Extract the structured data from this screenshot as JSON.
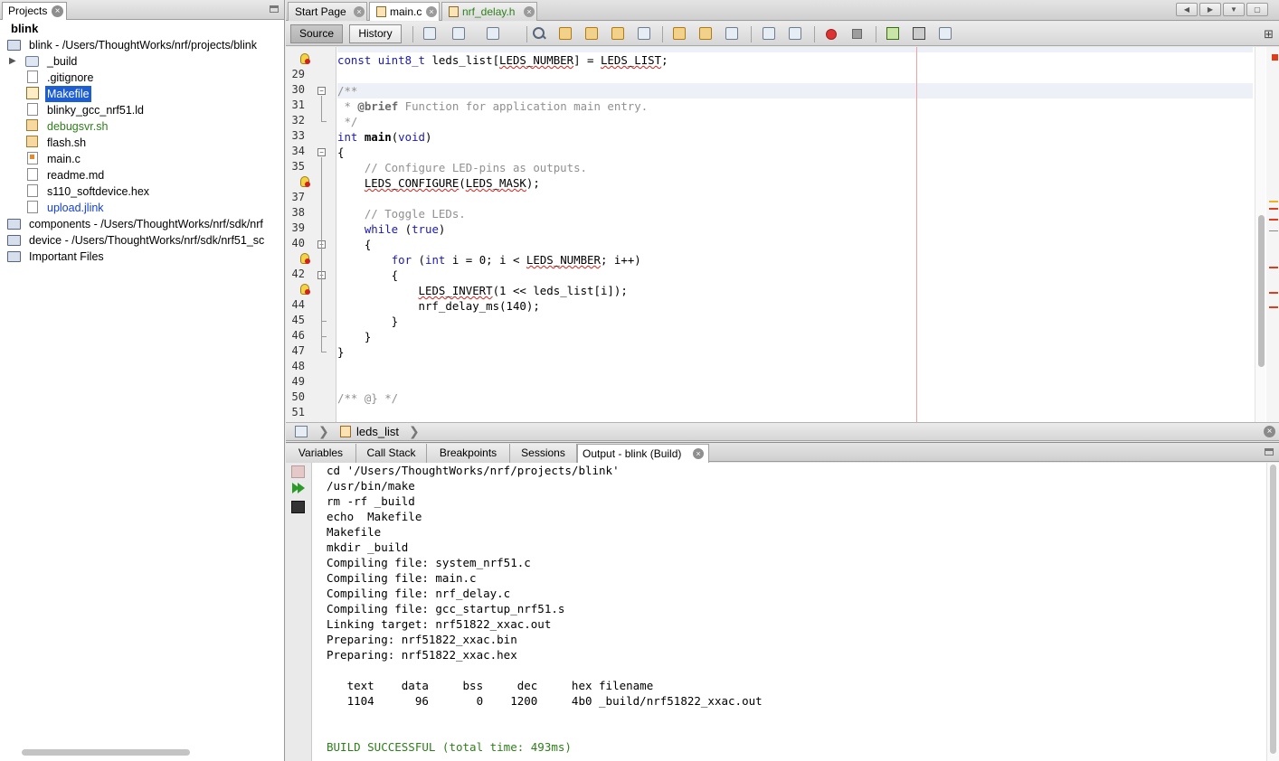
{
  "projects_panel": {
    "tab_label": "Projects",
    "tree": [
      {
        "label": "blink",
        "kind": "root"
      },
      {
        "label": "blink - /Users/ThoughtWorks/nrf/projects/blink",
        "kind": "project"
      },
      {
        "label": "_build",
        "kind": "folder"
      },
      {
        "label": ".gitignore",
        "kind": "file"
      },
      {
        "label": "Makefile",
        "kind": "makefile",
        "selected": true
      },
      {
        "label": "blinky_gcc_nrf51.ld",
        "kind": "file"
      },
      {
        "label": "debugsvr.sh",
        "kind": "shell",
        "color": "green"
      },
      {
        "label": "flash.sh",
        "kind": "shell"
      },
      {
        "label": "main.c",
        "kind": "c"
      },
      {
        "label": "readme.md",
        "kind": "file"
      },
      {
        "label": "s110_softdevice.hex",
        "kind": "file"
      },
      {
        "label": "upload.jlink",
        "kind": "file",
        "color": "blue"
      },
      {
        "label": "components - /Users/ThoughtWorks/nrf/sdk/nrf",
        "kind": "project"
      },
      {
        "label": "device - /Users/ThoughtWorks/nrf/sdk/nrf51_sc",
        "kind": "project"
      },
      {
        "label": "Important Files",
        "kind": "project"
      }
    ]
  },
  "editor_tabs": [
    {
      "label": "Start Page",
      "active": false
    },
    {
      "label": "main.c",
      "active": true
    },
    {
      "label": "nrf_delay.h",
      "active": false,
      "color": "green"
    }
  ],
  "editor_toolbar": {
    "source_label": "Source",
    "history_label": "History"
  },
  "code": {
    "line_numbers": [
      "",
      "29",
      "30",
      "31",
      "32",
      "33",
      "34",
      "35",
      "",
      "37",
      "38",
      "39",
      "40",
      "",
      "42",
      "",
      "44",
      "45",
      "46",
      "47",
      "48",
      "49",
      "50",
      "51"
    ],
    "lines": [
      [
        {
          "t": "const ",
          "c": "kw"
        },
        {
          "t": "uint8_t",
          "c": "ty"
        },
        {
          "t": " leds_list["
        },
        {
          "t": "LEDS_NUMBER",
          "c": "squig"
        },
        {
          "t": "] = "
        },
        {
          "t": "LEDS_LIST",
          "c": "squig"
        },
        {
          "t": ";"
        }
      ],
      [],
      [
        {
          "t": "/**",
          "c": "cm"
        }
      ],
      [
        {
          "t": " * ",
          "c": "cm"
        },
        {
          "t": "@brief",
          "c": "cmb"
        },
        {
          "t": " Function for application main entry.",
          "c": "cm"
        }
      ],
      [
        {
          "t": " */",
          "c": "cm"
        }
      ],
      [
        {
          "t": "int ",
          "c": "kw"
        },
        {
          "t": "main",
          "c": "fn"
        },
        {
          "t": "("
        },
        {
          "t": "void",
          "c": "kw"
        },
        {
          "t": ")"
        }
      ],
      [
        {
          "t": "{"
        }
      ],
      [
        {
          "t": "    // Configure LED-pins as outputs.",
          "c": "cm"
        }
      ],
      [
        {
          "t": "    "
        },
        {
          "t": "LEDS_CONFIGURE",
          "c": "squig"
        },
        {
          "t": "("
        },
        {
          "t": "LEDS_MASK",
          "c": "squig"
        },
        {
          "t": ");"
        }
      ],
      [],
      [
        {
          "t": "    // Toggle LEDs.",
          "c": "cm"
        }
      ],
      [
        {
          "t": "    "
        },
        {
          "t": "while",
          "c": "kw"
        },
        {
          "t": " ("
        },
        {
          "t": "true",
          "c": "tr"
        },
        {
          "t": ")"
        }
      ],
      [
        {
          "t": "    {"
        }
      ],
      [
        {
          "t": "        "
        },
        {
          "t": "for",
          "c": "kw"
        },
        {
          "t": " ("
        },
        {
          "t": "int",
          "c": "kw"
        },
        {
          "t": " i = 0; i < "
        },
        {
          "t": "LEDS_NUMBER",
          "c": "squig"
        },
        {
          "t": "; i++)"
        }
      ],
      [
        {
          "t": "        {"
        }
      ],
      [
        {
          "t": "            "
        },
        {
          "t": "LEDS_INVERT",
          "c": "squig"
        },
        {
          "t": "(1 << leds_list[i]);"
        }
      ],
      [
        {
          "t": "            nrf_delay_ms(140);"
        }
      ],
      [
        {
          "t": "        }"
        }
      ],
      [
        {
          "t": "    }"
        }
      ],
      [
        {
          "t": "}"
        }
      ],
      [],
      [],
      [
        {
          "t": "/** @} */",
          "c": "cm"
        }
      ],
      []
    ]
  },
  "breadcrumb": {
    "item": "leds_list"
  },
  "bottom_tabs": [
    {
      "label": "Variables",
      "active": false
    },
    {
      "label": "Call Stack",
      "active": false
    },
    {
      "label": "Breakpoints",
      "active": false
    },
    {
      "label": "Sessions",
      "active": false
    },
    {
      "label": "Output - blink (Build)",
      "active": true
    }
  ],
  "output": {
    "lines": [
      "cd '/Users/ThoughtWorks/nrf/projects/blink'",
      "/usr/bin/make",
      "rm -rf _build",
      "echo  Makefile",
      "Makefile",
      "mkdir _build",
      "Compiling file: system_nrf51.c",
      "Compiling file: main.c",
      "Compiling file: nrf_delay.c",
      "Compiling file: gcc_startup_nrf51.s",
      "Linking target: nrf51822_xxac.out",
      "Preparing: nrf51822_xxac.bin",
      "Preparing: nrf51822_xxac.hex",
      "",
      "   text    data     bss     dec     hex filename",
      "   1104      96       0    1200     4b0 _build/nrf51822_xxac.out",
      "",
      "",
      "BUILD SUCCESSFUL (total time: 493ms)"
    ],
    "success_line_index": 18
  },
  "colors": {
    "selection": "#1d5fd3",
    "success_text": "#2d7f1a",
    "keyword": "#1a1ab4",
    "error_mark": "#e03c1c"
  }
}
